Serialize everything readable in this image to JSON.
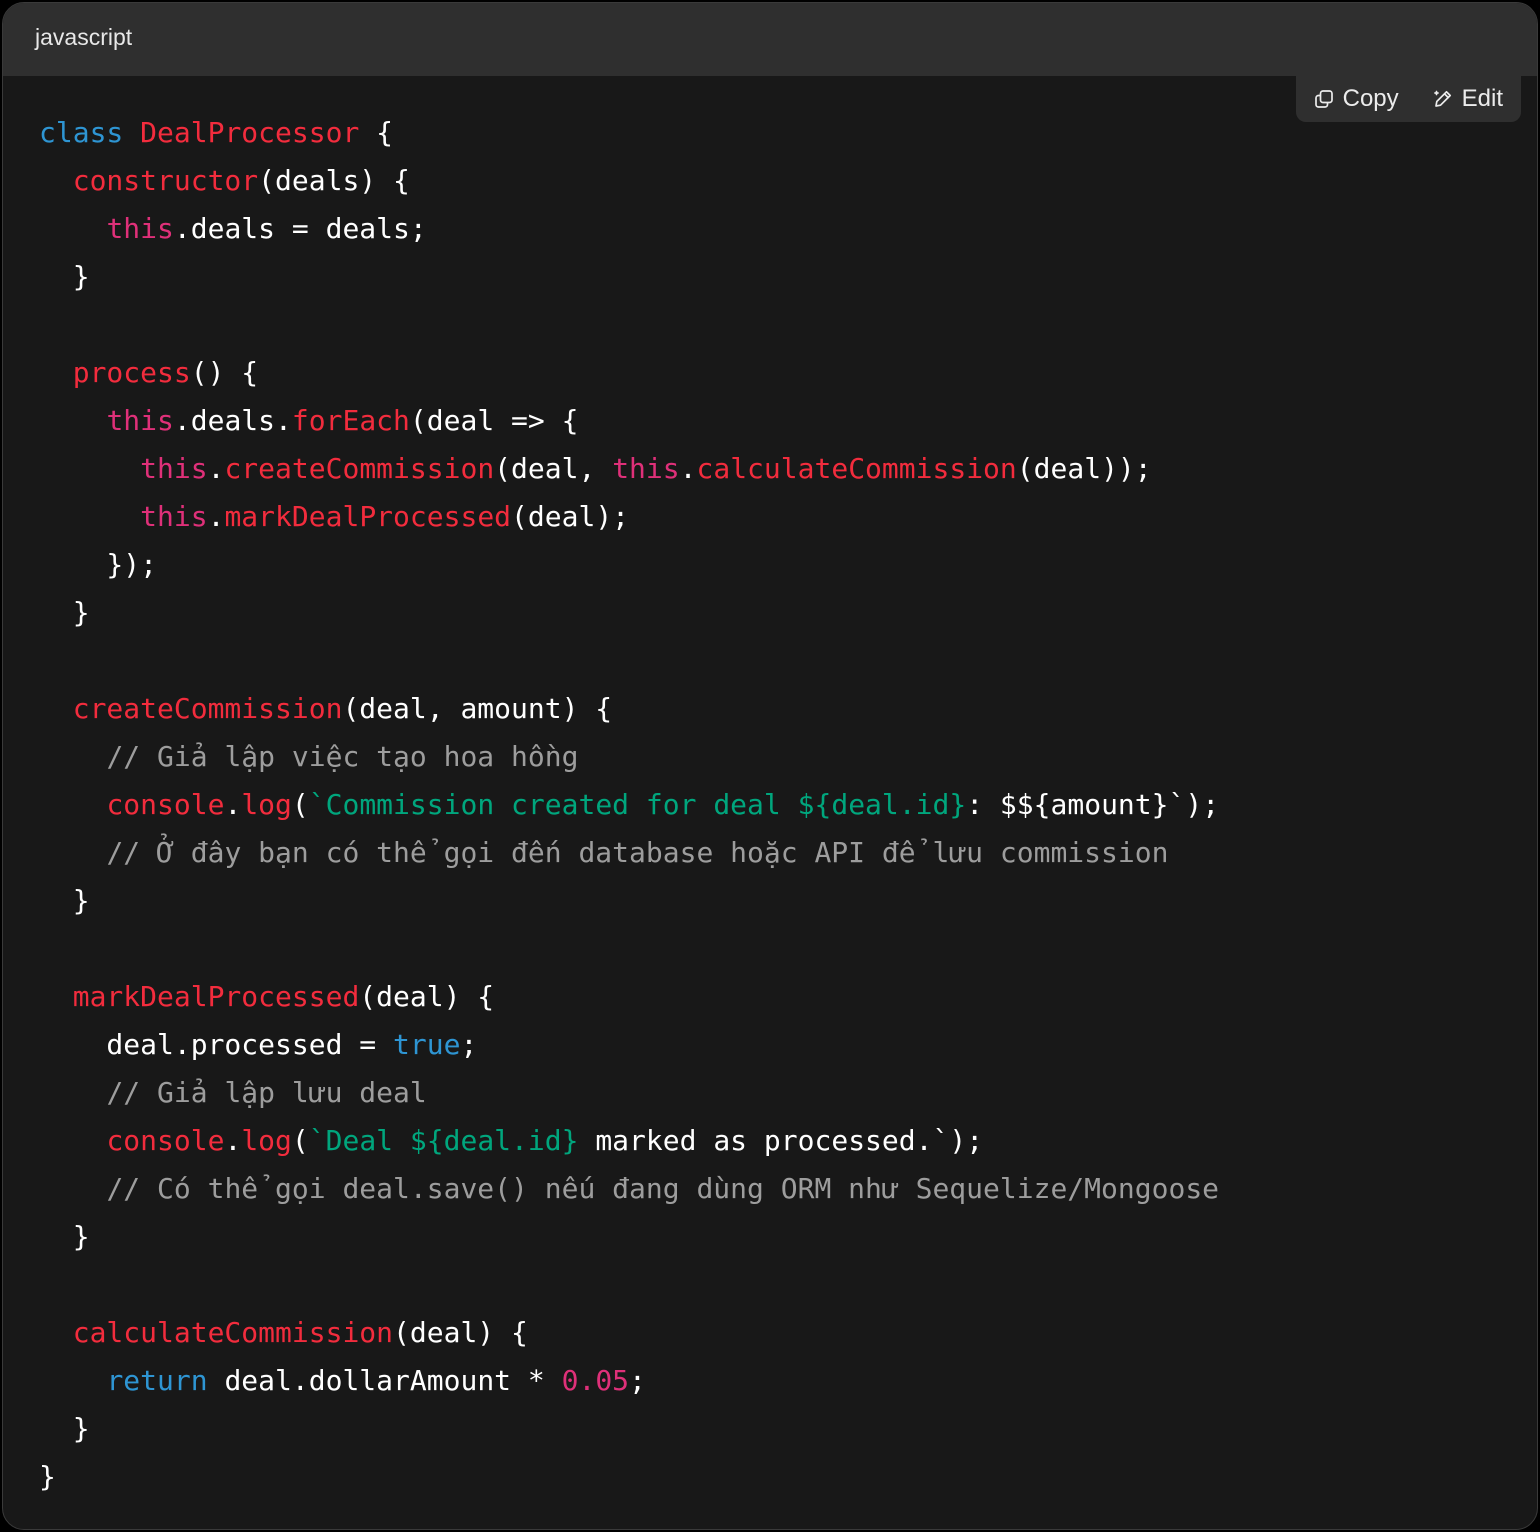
{
  "header": {
    "language": "javascript"
  },
  "toolbar": {
    "copy_label": "Copy",
    "edit_label": "Edit",
    "copy_icon": "copy-icon",
    "edit_icon": "pencil-icon"
  },
  "colors": {
    "background": "#181818",
    "header": "#2f2f2f",
    "keyword": "#2e95d3",
    "function": "#f22c3d",
    "this": "#df3079",
    "string": "#00a67d",
    "number": "#df3079",
    "comment": "#9d9d9d",
    "text": "#ffffff"
  },
  "code": {
    "lines": [
      [
        [
          "k",
          "class"
        ],
        [
          "p",
          " "
        ],
        [
          "f",
          "DealProcessor"
        ],
        [
          "p",
          " {"
        ]
      ],
      [
        [
          "p",
          "  "
        ],
        [
          "f",
          "constructor"
        ],
        [
          "p",
          "(deals) {"
        ]
      ],
      [
        [
          "p",
          "    "
        ],
        [
          "t",
          "this"
        ],
        [
          "p",
          ".deals = deals;"
        ]
      ],
      [
        [
          "p",
          "  }"
        ]
      ],
      [],
      [
        [
          "p",
          "  "
        ],
        [
          "f",
          "process"
        ],
        [
          "p",
          "() {"
        ]
      ],
      [
        [
          "p",
          "    "
        ],
        [
          "t",
          "this"
        ],
        [
          "p",
          ".deals."
        ],
        [
          "f",
          "forEach"
        ],
        [
          "p",
          "(deal => {"
        ]
      ],
      [
        [
          "p",
          "      "
        ],
        [
          "t",
          "this"
        ],
        [
          "p",
          "."
        ],
        [
          "f",
          "createCommission"
        ],
        [
          "p",
          "(deal, "
        ],
        [
          "t",
          "this"
        ],
        [
          "p",
          "."
        ],
        [
          "f",
          "calculateCommission"
        ],
        [
          "p",
          "(deal));"
        ]
      ],
      [
        [
          "p",
          "      "
        ],
        [
          "t",
          "this"
        ],
        [
          "p",
          "."
        ],
        [
          "f",
          "markDealProcessed"
        ],
        [
          "p",
          "(deal);"
        ]
      ],
      [
        [
          "p",
          "    });"
        ]
      ],
      [
        [
          "p",
          "  }"
        ]
      ],
      [],
      [
        [
          "p",
          "  "
        ],
        [
          "f",
          "createCommission"
        ],
        [
          "p",
          "(deal, amount) {"
        ]
      ],
      [
        [
          "p",
          "    "
        ],
        [
          "c",
          "// Giả lập việc tạo hoa hồng"
        ]
      ],
      [
        [
          "p",
          "    "
        ],
        [
          "f",
          "console"
        ],
        [
          "p",
          "."
        ],
        [
          "f",
          "log"
        ],
        [
          "p",
          "("
        ],
        [
          "s",
          "`Commission created for deal ${deal.id}"
        ],
        [
          "p",
          ": $${amount}`);"
        ]
      ],
      [
        [
          "p",
          "    "
        ],
        [
          "c",
          "// Ở đây bạn có thể gọi đến database hoặc API để lưu commission"
        ]
      ],
      [
        [
          "p",
          "  }"
        ]
      ],
      [],
      [
        [
          "p",
          "  "
        ],
        [
          "f",
          "markDealProcessed"
        ],
        [
          "p",
          "(deal) {"
        ]
      ],
      [
        [
          "p",
          "    deal.processed = "
        ],
        [
          "k",
          "true"
        ],
        [
          "p",
          ";"
        ]
      ],
      [
        [
          "p",
          "    "
        ],
        [
          "c",
          "// Giả lập lưu deal"
        ]
      ],
      [
        [
          "p",
          "    "
        ],
        [
          "f",
          "console"
        ],
        [
          "p",
          "."
        ],
        [
          "f",
          "log"
        ],
        [
          "p",
          "("
        ],
        [
          "s",
          "`Deal ${deal.id}"
        ],
        [
          "p",
          " marked as processed.`);"
        ]
      ],
      [
        [
          "p",
          "    "
        ],
        [
          "c",
          "// Có thể gọi deal.save() nếu đang dùng ORM như Sequelize/Mongoose"
        ]
      ],
      [
        [
          "p",
          "  }"
        ]
      ],
      [],
      [
        [
          "p",
          "  "
        ],
        [
          "f",
          "calculateCommission"
        ],
        [
          "p",
          "(deal) {"
        ]
      ],
      [
        [
          "p",
          "    "
        ],
        [
          "k",
          "return"
        ],
        [
          "p",
          " deal.dollarAmount * "
        ],
        [
          "n",
          "0.05"
        ],
        [
          "p",
          ";"
        ]
      ],
      [
        [
          "p",
          "  }"
        ]
      ],
      [
        [
          "p",
          "}"
        ]
      ]
    ]
  }
}
